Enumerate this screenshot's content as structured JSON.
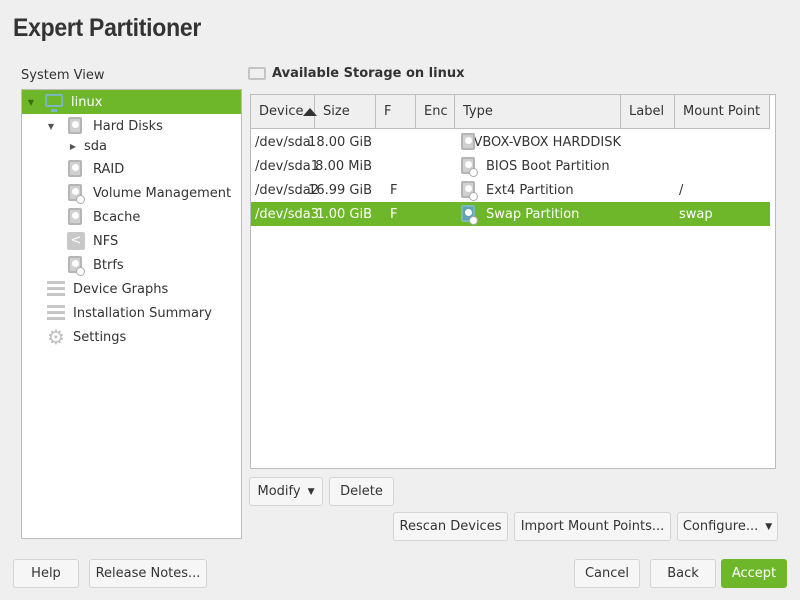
{
  "title": "Expert Partitioner",
  "system_view": {
    "label": "System View",
    "items": [
      {
        "label": "linux",
        "icon": "monitor-icon",
        "selected": true,
        "expanded": true
      },
      {
        "label": "Hard Disks",
        "icon": "hard-disk-icon",
        "expanded": true
      },
      {
        "label": "sda",
        "icon": "",
        "collapsed": true
      },
      {
        "label": "RAID",
        "icon": "raid-icon"
      },
      {
        "label": "Volume Management",
        "icon": "volume-management-icon"
      },
      {
        "label": "Bcache",
        "icon": "bcache-icon"
      },
      {
        "label": "NFS",
        "icon": "nfs-share-icon"
      },
      {
        "label": "Btrfs",
        "icon": "btrfs-icon"
      },
      {
        "label": "Device Graphs",
        "icon": "device-graphs-icon"
      },
      {
        "label": "Installation Summary",
        "icon": "installation-summary-icon"
      },
      {
        "label": "Settings",
        "icon": "gear-icon"
      }
    ]
  },
  "storage": {
    "heading": "Available Storage on linux",
    "columns": [
      "Device",
      "Size",
      "F",
      "Enc",
      "Type",
      "Label",
      "Mount Point"
    ],
    "rows": [
      {
        "device": "/dev/sda",
        "size": "18.00 GiB",
        "f": "",
        "enc": "",
        "type": "VBOX-VBOX HARDDISK",
        "label": "",
        "mount": ""
      },
      {
        "device": "/dev/sda1",
        "size": "8.00 MiB",
        "f": "",
        "enc": "",
        "type": "BIOS Boot Partition",
        "label": "",
        "mount": ""
      },
      {
        "device": "/dev/sda2",
        "size": "16.99 GiB",
        "f": "F",
        "enc": "",
        "type": "Ext4 Partition",
        "label": "",
        "mount": "/"
      },
      {
        "device": "/dev/sda3",
        "size": "1.00 GiB",
        "f": "F",
        "enc": "",
        "type": "Swap Partition",
        "label": "",
        "mount": "swap"
      }
    ]
  },
  "buttons": {
    "modify": "Modify",
    "delete": "Delete",
    "rescan": "Rescan Devices",
    "import": "Import Mount Points...",
    "configure": "Configure...",
    "help": "Help",
    "release_notes": "Release Notes...",
    "cancel": "Cancel",
    "back": "Back",
    "accept": "Accept"
  },
  "colors": {
    "accent": "#6eb72a"
  }
}
